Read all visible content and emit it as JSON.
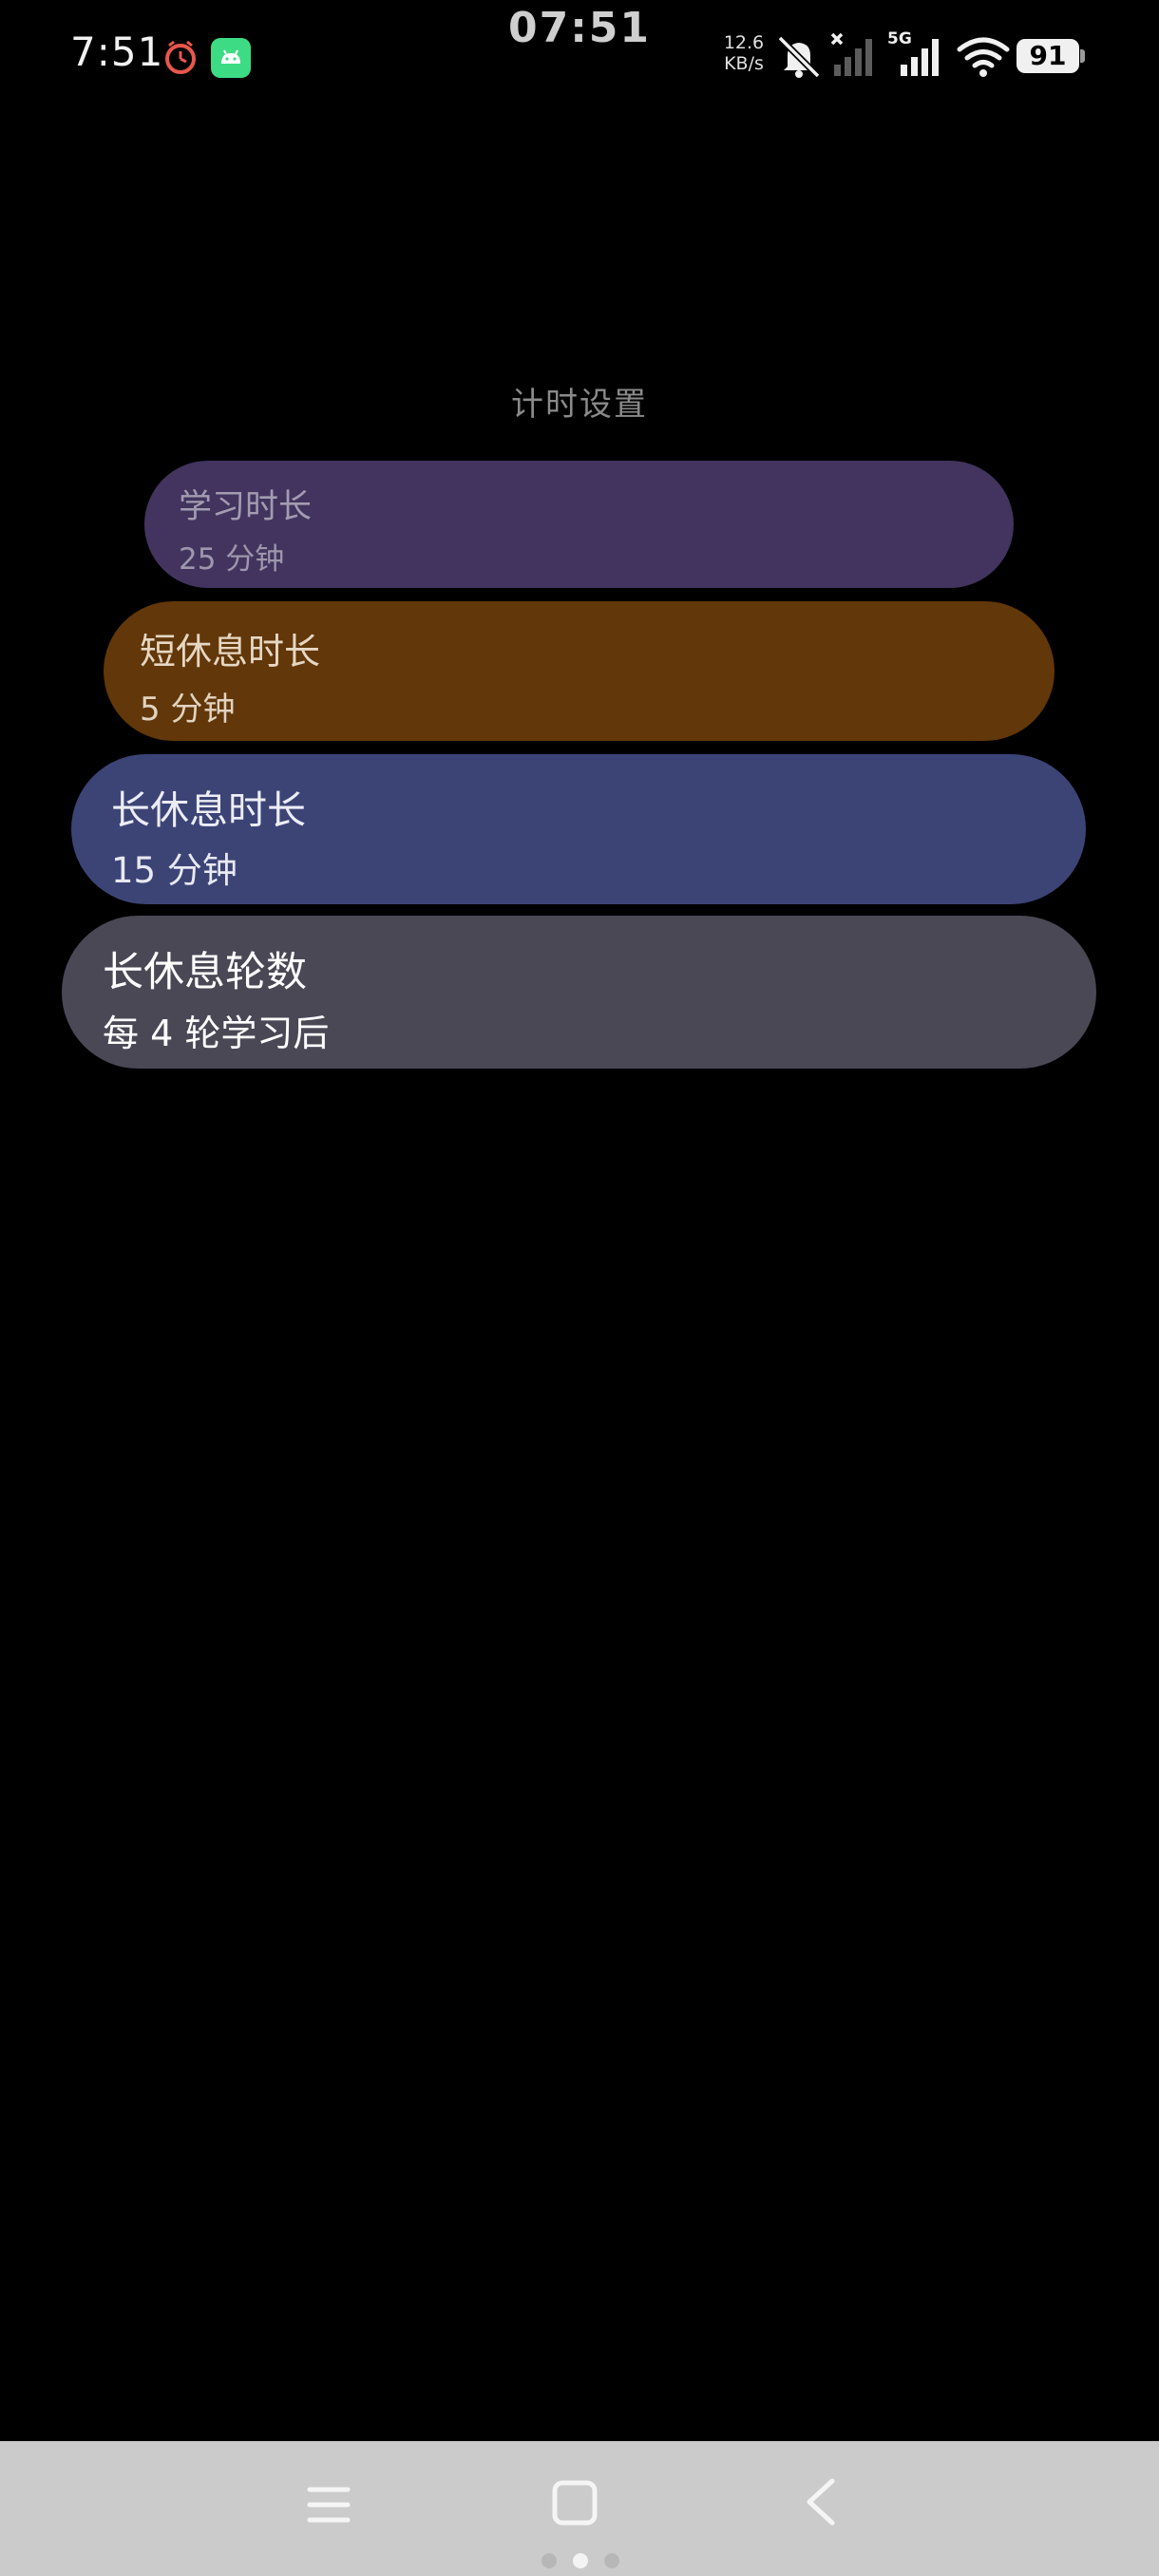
{
  "status_bar": {
    "time": "7:51",
    "clock": "07:51",
    "net_speed_value": "12.6",
    "net_speed_unit": "KB/s",
    "network_type": "5G",
    "battery": "91",
    "icons": [
      "timer-app-icon",
      "android-app-icon",
      "mute-icon",
      "sim-no-signal-icon",
      "sim-5g-signal-icon",
      "wifi-icon",
      "battery-icon"
    ]
  },
  "page": {
    "title": "计时设置"
  },
  "settings": [
    {
      "label": "学习时长",
      "value": "25 分钟",
      "color": "#42345e"
    },
    {
      "label": "短休息时长",
      "value": "5 分钟",
      "color": "#623709"
    },
    {
      "label": "长休息时长",
      "value": "15 分钟",
      "color": "#3c4476"
    },
    {
      "label": "长休息轮数",
      "value": "每 4 轮学习后",
      "color": "#4b4856"
    }
  ],
  "nav_bar": {
    "background": "#cbcbcb",
    "buttons": [
      "menu-icon",
      "home-icon",
      "back-icon"
    ],
    "page_dots": {
      "count": 3,
      "active_index": 1
    }
  }
}
